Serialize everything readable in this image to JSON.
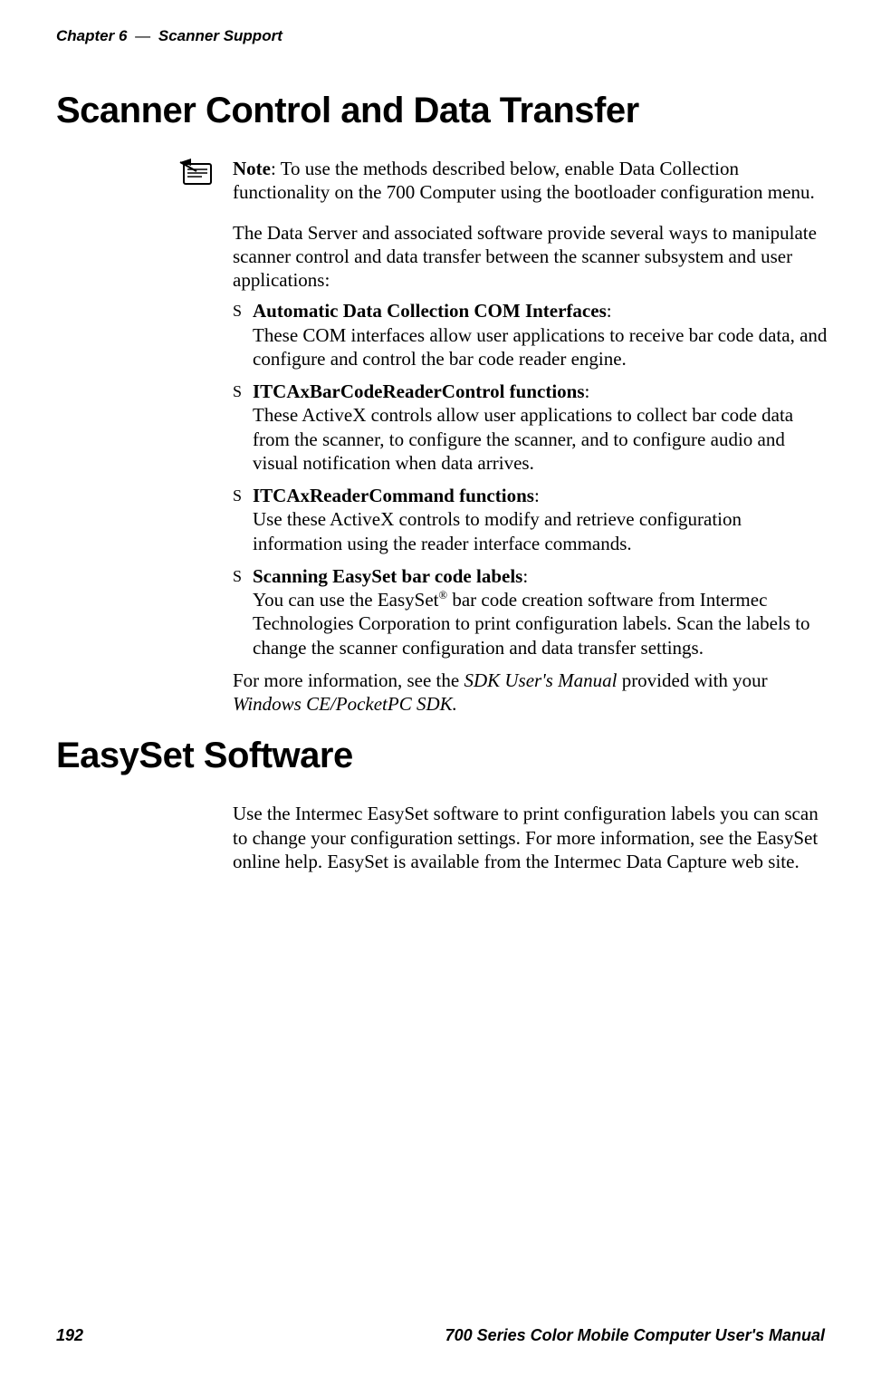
{
  "header": {
    "chapter": "Chapter 6",
    "dash": "—",
    "title": "Scanner Support"
  },
  "main": {
    "h1": "Scanner Control and Data Transfer",
    "note": {
      "label": "Note",
      "text": ": To use the methods described below, enable Data Collection functionality on the 700 Computer using the bootloader configuration menu."
    },
    "intro": "The Data Server and associated software provide several ways to manipulate scanner control and data transfer between the scanner subsystem and user applications:",
    "features": [
      {
        "title": "Automatic Data Collection COM Interfaces",
        "body": "These COM interfaces allow user applications to receive bar code data, and configure and control the bar code reader engine."
      },
      {
        "title": "ITCAxBarCodeReaderControl functions",
        "body": "These ActiveX controls allow user applications to collect bar code data from the scanner, to configure the scanner, and to configure audio and visual notification when data arrives."
      },
      {
        "title": "ITCAxReaderCommand functions",
        "body": "Use these ActiveX controls to modify and retrieve configuration information using the reader interface commands."
      },
      {
        "title": "Scanning EasySet bar code labels",
        "body_pre": "You can use the EasySet",
        "body_sup": "®",
        "body_post": " bar code creation software from Intermec Technologies Corporation to print configuration labels. Scan the labels to change the scanner configuration and data transfer settings."
      }
    ],
    "closing_pre": "For more information, see the ",
    "closing_it": "SDK User's Manual",
    "closing_mid": " provided with your ",
    "closing_it2": "Windows CE/PocketPC SDK.",
    "h2": "EasySet Software",
    "easyset_para": "Use the Intermec EasySet software to print configuration labels you can scan to change your configuration settings. For more information, see the EasySet online help. EasySet is available from the Intermec Data Capture web site."
  },
  "footer": {
    "page": "192",
    "doc": "700 Series Color Mobile Computer User's Manual"
  }
}
